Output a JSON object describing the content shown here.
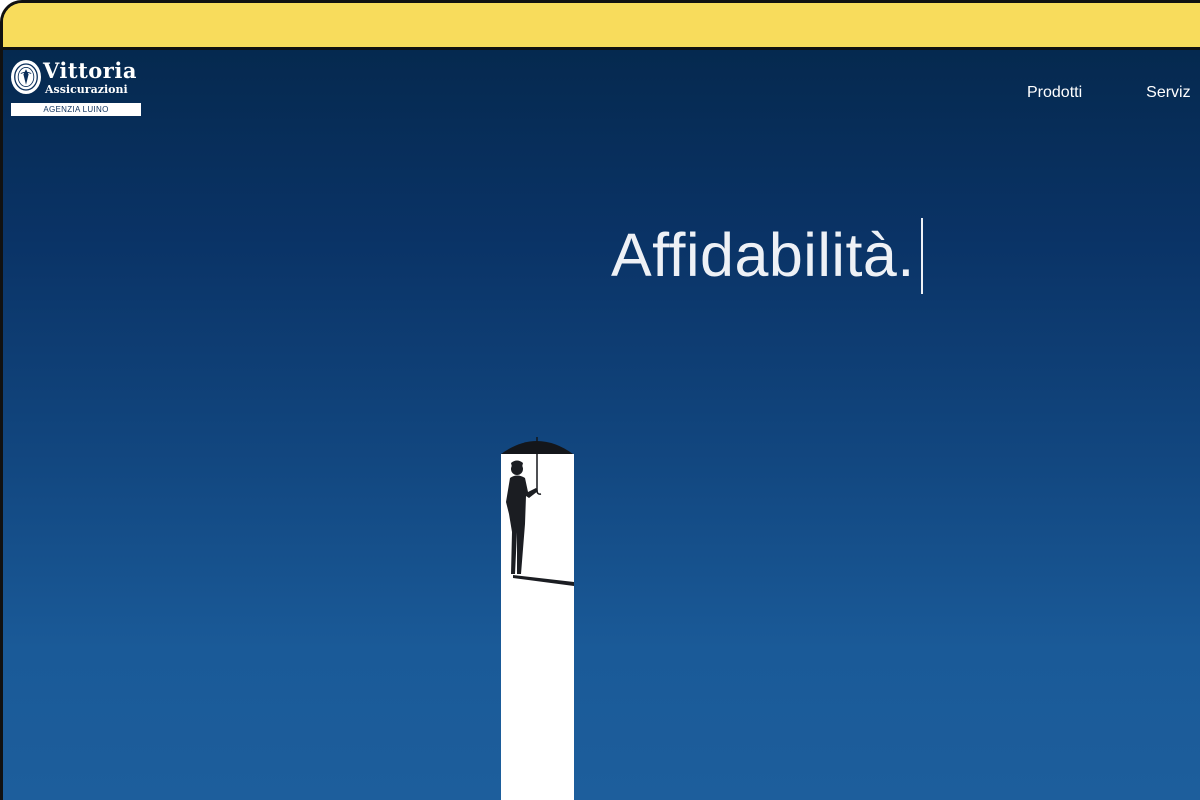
{
  "brand": {
    "name": "Vittoria",
    "subtitle": "Assicurazioni",
    "agency": "AGENZIA LUINO",
    "emblem_icon": "vittoria-seal-icon"
  },
  "nav": {
    "items": [
      {
        "label": "Prodotti"
      },
      {
        "label": "Serviz"
      }
    ]
  },
  "hero": {
    "headline": "Affidabilità."
  },
  "colors": {
    "topbar": "#f8dc5c",
    "hero_top": "#05294f",
    "hero_bottom": "#1d5e9c",
    "text": "#ffffff"
  }
}
